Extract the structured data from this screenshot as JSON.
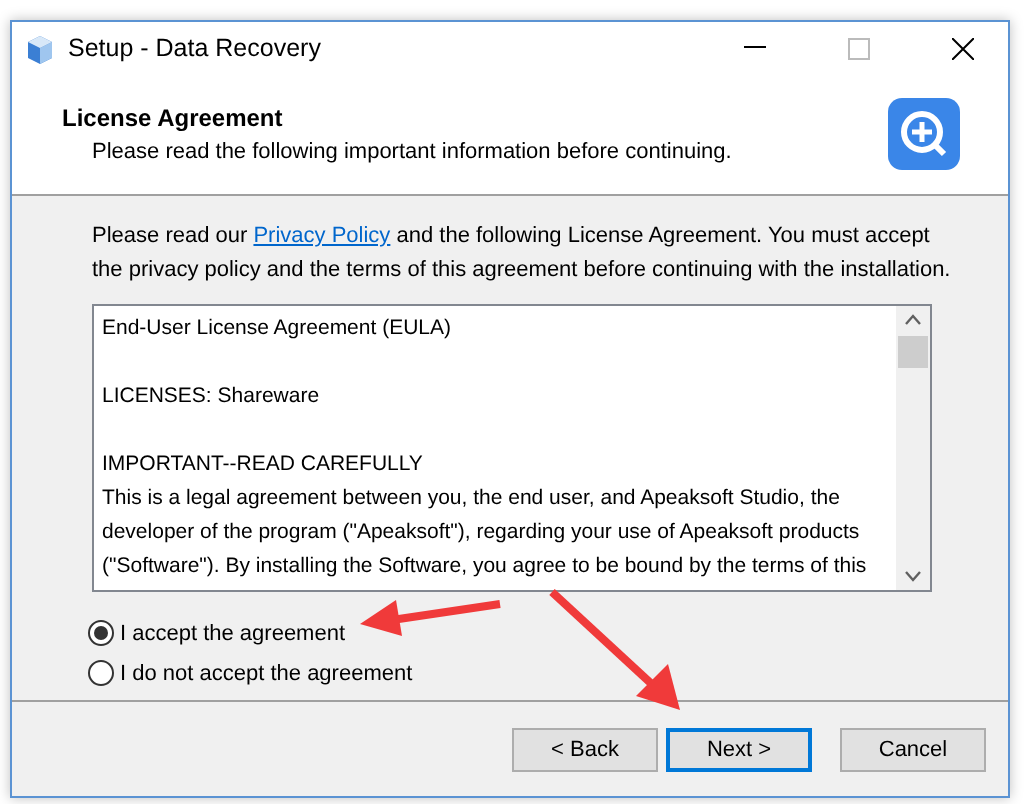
{
  "window": {
    "title": "Setup - Data Recovery"
  },
  "header": {
    "title": "License Agreement",
    "subtitle": "Please read the following important information before continuing."
  },
  "intro": {
    "before": "Please read our ",
    "link": "Privacy Policy",
    "after": " and the following License Agreement. You must accept the privacy policy and the terms of this agreement before continuing with the installation."
  },
  "license_text": [
    {
      "lines": [
        "End-User License Agreement (EULA)"
      ]
    },
    {
      "lines": [
        "LICENSES: Shareware"
      ]
    },
    {
      "lines": [
        "IMPORTANT--READ CAREFULLY",
        "This is a legal agreement between you, the end user, and Apeaksoft Studio, the",
        "developer of the program (\"Apeaksoft\"), regarding your use of Apeaksoft products",
        "(\"Software\"). By installing the Software, you agree to be bound by the terms of this"
      ]
    }
  ],
  "options": [
    {
      "label": "I accept the agreement",
      "selected": true
    },
    {
      "label": "I do not accept the agreement",
      "selected": false
    }
  ],
  "buttons": [
    {
      "label": "< Back",
      "focused": false
    },
    {
      "label": "Next >",
      "focused": true
    },
    {
      "label": "Cancel",
      "focused": false
    }
  ]
}
